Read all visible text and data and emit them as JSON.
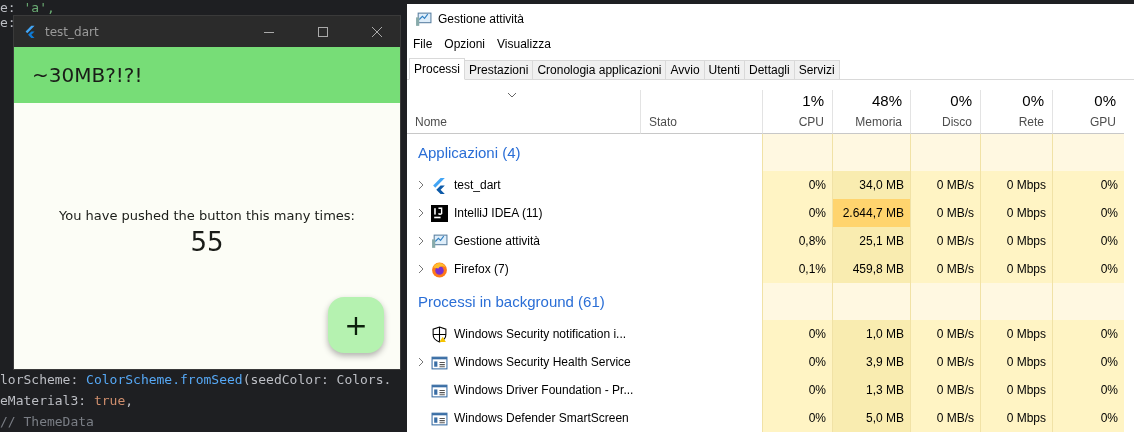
{
  "editor": {
    "top_lines": [
      {
        "tokens": [
          {
            "kind": "plain",
            "text": "e: "
          },
          {
            "kind": "string",
            "text": "'a',"
          }
        ]
      },
      {
        "tokens": [
          {
            "kind": "plain",
            "text": "e:"
          }
        ]
      }
    ],
    "bottom_lines": [
      {
        "tokens": [
          {
            "kind": "plain",
            "text": "lorScheme: "
          },
          {
            "kind": "type",
            "text": "ColorScheme.fromSeed"
          },
          {
            "kind": "plain",
            "text": "(seedColor: Colors."
          }
        ]
      },
      {
        "tokens": [
          {
            "kind": "plain",
            "text": "eMaterial3: "
          },
          {
            "kind": "keyword",
            "text": "true"
          },
          {
            "kind": "plain",
            "text": ","
          }
        ]
      },
      {
        "tokens": [
          {
            "kind": "comment",
            "text": "// ThemeData"
          }
        ]
      }
    ]
  },
  "app_window": {
    "title": "test_dart",
    "header": "~30MB?!?!",
    "message": "You have pushed the button this many times:",
    "counter": "55",
    "fab": "+"
  },
  "task_manager": {
    "title": "Gestione attività",
    "menu": [
      "File",
      "Opzioni",
      "Visualizza"
    ],
    "tabs": [
      {
        "label": "Processi",
        "selected": true
      },
      {
        "label": "Prestazioni",
        "selected": false
      },
      {
        "label": "Cronologia applicazioni",
        "selected": false
      },
      {
        "label": "Avvio",
        "selected": false
      },
      {
        "label": "Utenti",
        "selected": false
      },
      {
        "label": "Dettagli",
        "selected": false
      },
      {
        "label": "Servizi",
        "selected": false
      }
    ],
    "columns": [
      {
        "name": "Nome"
      },
      {
        "name": "Stato"
      },
      {
        "name": "CPU",
        "total": "1%"
      },
      {
        "name": "Memoria",
        "total": "48%"
      },
      {
        "name": "Disco",
        "total": "0%"
      },
      {
        "name": "Rete",
        "total": "0%"
      },
      {
        "name": "GPU",
        "total": "0%"
      }
    ],
    "groups": [
      {
        "title": "Applicazioni (4)",
        "rows": [
          {
            "kind": "flutter",
            "expandable": true,
            "name": "test_dart",
            "cpu": "0%",
            "memory": "34,0 MB",
            "memory_high": false,
            "disk": "0 MB/s",
            "network": "0 Mbps",
            "gpu": "0%"
          },
          {
            "kind": "intellij",
            "expandable": true,
            "name": "IntelliJ IDEA (11)",
            "cpu": "0%",
            "memory": "2.644,7 MB",
            "memory_high": true,
            "disk": "0 MB/s",
            "network": "0 Mbps",
            "gpu": "0%"
          },
          {
            "kind": "monitor",
            "expandable": true,
            "name": "Gestione attività",
            "cpu": "0,8%",
            "memory": "25,1 MB",
            "memory_high": false,
            "disk": "0 MB/s",
            "network": "0 Mbps",
            "gpu": "0%"
          },
          {
            "kind": "firefox",
            "expandable": true,
            "name": "Firefox (7)",
            "cpu": "0,1%",
            "memory": "459,8 MB",
            "memory_high": false,
            "disk": "0 MB/s",
            "network": "0 Mbps",
            "gpu": "0%"
          }
        ]
      },
      {
        "title": "Processi in background (61)",
        "rows": [
          {
            "kind": "shield",
            "expandable": false,
            "name": "Windows Security notification i...",
            "cpu": "0%",
            "memory": "1,0 MB",
            "memory_high": false,
            "disk": "0 MB/s",
            "network": "0 Mbps",
            "gpu": "0%"
          },
          {
            "kind": "service",
            "expandable": true,
            "name": "Windows Security Health Service",
            "cpu": "0%",
            "memory": "3,9 MB",
            "memory_high": false,
            "disk": "0 MB/s",
            "network": "0 Mbps",
            "gpu": "0%"
          },
          {
            "kind": "service",
            "expandable": false,
            "name": "Windows Driver Foundation - Pr...",
            "cpu": "0%",
            "memory": "1,3 MB",
            "memory_high": false,
            "disk": "0 MB/s",
            "network": "0 Mbps",
            "gpu": "0%"
          },
          {
            "kind": "service",
            "expandable": false,
            "name": "Windows Defender SmartScreen",
            "cpu": "0%",
            "memory": "5,0 MB",
            "memory_high": false,
            "disk": "0 MB/s",
            "network": "0 Mbps",
            "gpu": "0%"
          }
        ]
      }
    ]
  }
}
